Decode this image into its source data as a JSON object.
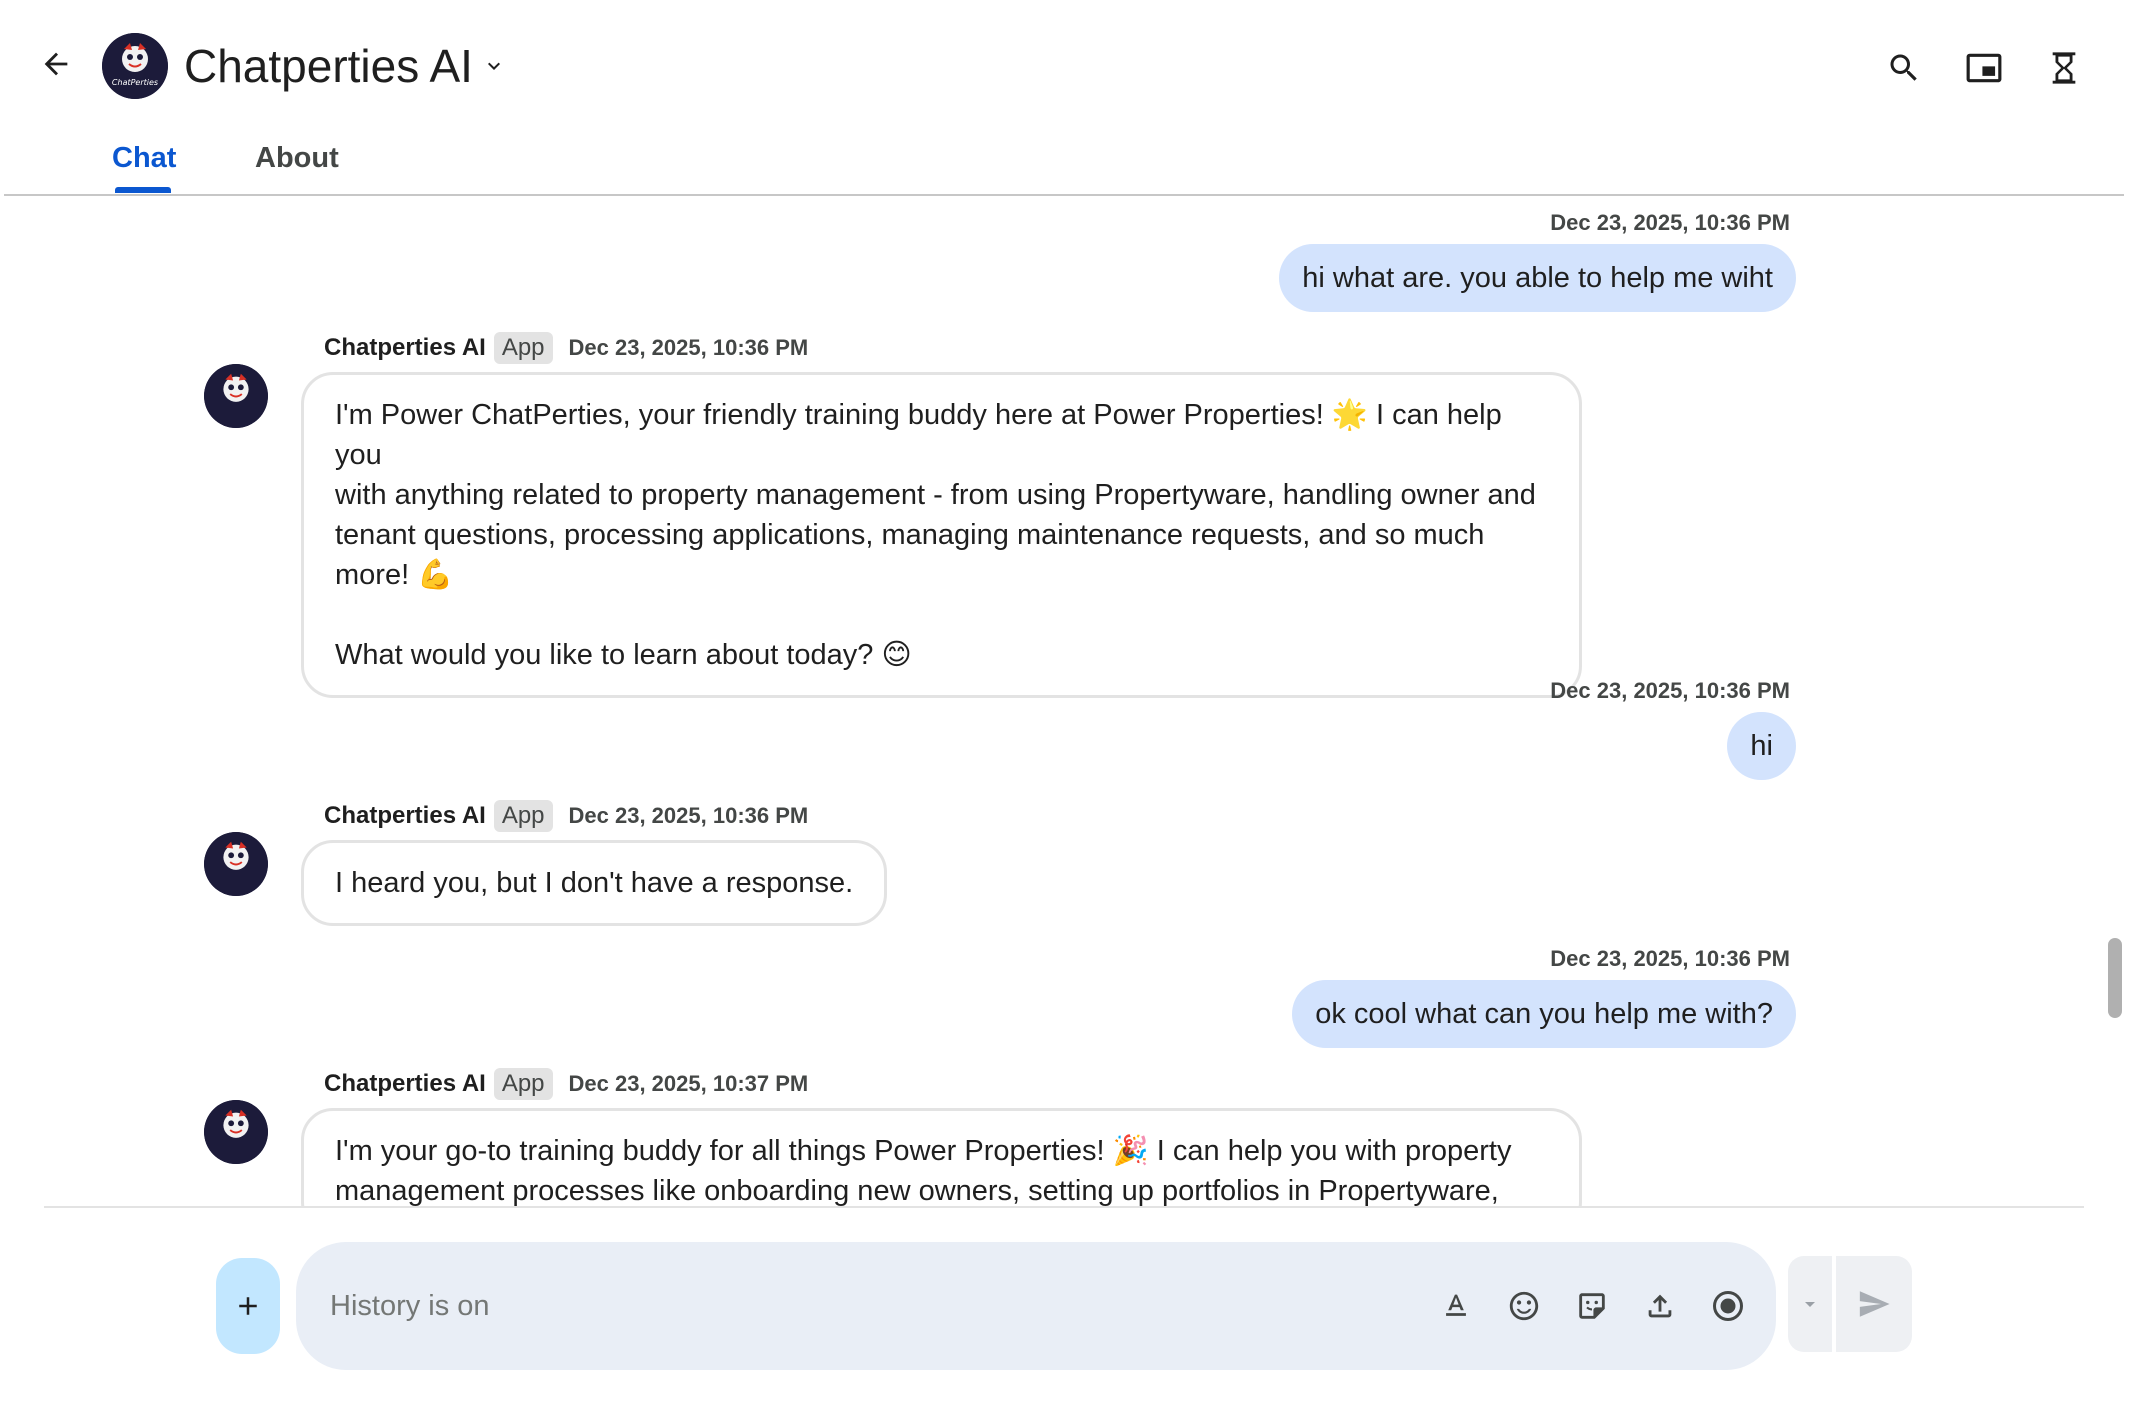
{
  "header": {
    "title": "Chatperties AI",
    "logo_text": "ChatPerties",
    "icons": [
      "back-arrow-icon",
      "chevron-down-icon",
      "search-icon",
      "picture-in-picture-icon",
      "hourglass-icon"
    ]
  },
  "tabs": [
    {
      "label": "Chat",
      "active": true
    },
    {
      "label": "About",
      "active": false
    }
  ],
  "messages": [
    {
      "sender": "user",
      "time": "Dec 23, 2025, 10:36 PM",
      "text": "hi what are. you able to help me wiht"
    },
    {
      "sender": "bot",
      "name": "Chatperties AI",
      "chip": "App",
      "time": "Dec 23, 2025, 10:36 PM",
      "text": "I'm Power ChatPerties, your friendly training buddy here at Power Properties! 🌟 I can help you\nwith anything related to property management - from using Propertyware, handling owner and\ntenant questions, processing applications, managing maintenance requests, and so much\nmore! 💪\n\nWhat would you like to learn about today? 😊"
    },
    {
      "sender": "user",
      "time": "Dec 23, 2025, 10:36 PM",
      "text": "hi"
    },
    {
      "sender": "bot",
      "name": "Chatperties AI",
      "chip": "App",
      "time": "Dec 23, 2025, 10:36 PM",
      "text": "I heard you, but I don't have a response."
    },
    {
      "sender": "user",
      "time": "Dec 23, 2025, 10:36 PM",
      "text": "ok cool what can you help me with?"
    },
    {
      "sender": "bot",
      "name": "Chatperties AI",
      "chip": "App",
      "time": "Dec 23, 2025, 10:37 PM",
      "text": "I'm your go-to training buddy for all things Power Properties! 🎉 I can help you with property\nmanagement processes like onboarding new owners, setting up portfolios in Propertyware,"
    }
  ],
  "composer": {
    "placeholder": "History is on",
    "icons": [
      "text-format-icon",
      "emoji-icon",
      "sticker-icon",
      "upload-icon",
      "record-icon",
      "send-icon"
    ]
  },
  "colors": {
    "accent": "#0b57d0",
    "user_bubble": "#d3e3fd",
    "composer_bg": "#e9eef6",
    "plus_button": "#c2e7ff"
  }
}
